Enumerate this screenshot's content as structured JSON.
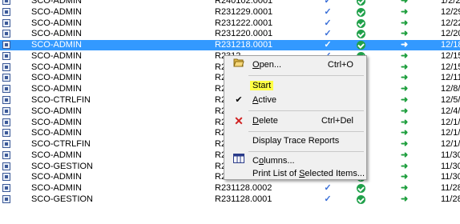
{
  "rows": [
    {
      "user": "SCO-ADMIN",
      "job": "R240102.0001",
      "date": "1/2/2"
    },
    {
      "user": "SCO-ADMIN",
      "job": "R231229.0001",
      "date": "12/29"
    },
    {
      "user": "SCO-ADMIN",
      "job": "R231222.0001",
      "date": "12/22"
    },
    {
      "user": "SCO-ADMIN",
      "job": "R231220.0001",
      "date": "12/20"
    },
    {
      "user": "SCO-ADMIN",
      "job": "R231218.0001",
      "date": "12/18",
      "selected": true
    },
    {
      "user": "SCO-ADMIN",
      "job": "R2312",
      "date": "12/15"
    },
    {
      "user": "SCO-ADMIN",
      "job": "R2312",
      "date": "12/15"
    },
    {
      "user": "SCO-ADMIN",
      "job": "R2312",
      "date": "12/11"
    },
    {
      "user": "SCO-ADMIN",
      "job": "R2312",
      "date": "12/8/"
    },
    {
      "user": "SCO-CTRLFIN",
      "job": "R2312",
      "date": "12/5/"
    },
    {
      "user": "SCO-ADMIN",
      "job": "R2312",
      "date": "12/4/"
    },
    {
      "user": "SCO-ADMIN",
      "job": "R2312",
      "date": "12/1/"
    },
    {
      "user": "SCO-ADMIN",
      "job": "R2312",
      "date": "12/1/"
    },
    {
      "user": "SCO-CTRLFIN",
      "job": "R2312",
      "date": "12/1/"
    },
    {
      "user": "SCO-ADMIN",
      "job": "R2311",
      "date": "11/30"
    },
    {
      "user": "SCO-GESTION",
      "job": "R231130.0002",
      "date": "11/30"
    },
    {
      "user": "SCO-ADMIN",
      "job": "R231130.0001",
      "date": "11/30"
    },
    {
      "user": "SCO-ADMIN",
      "job": "R231128.0002",
      "date": "11/28"
    },
    {
      "user": "SCO-GESTION",
      "job": "R231128.0001",
      "date": "11/28"
    }
  ],
  "glyphs": {
    "check": "✓",
    "arrow": "➜"
  },
  "menu": {
    "open": "Open...",
    "open_shortcut": "Ctrl+O",
    "start": "Start",
    "active": "Active",
    "active_checked": "✔",
    "delete": "Delete",
    "delete_shortcut": "Ctrl+Del",
    "delete_icon": "✕",
    "trace": "Display Trace Reports",
    "columns": "Columns...",
    "print": "Print List of Selected Items...",
    "icons": {
      "open": "folder-open-icon",
      "delete": "x-icon",
      "columns": "columns-icon"
    },
    "highlight_color": "#ffff44"
  },
  "colors": {
    "selection": "#3399ff",
    "ok": "#20a04a",
    "check": "#3a6fd8",
    "arrow": "#1c9e3c"
  }
}
